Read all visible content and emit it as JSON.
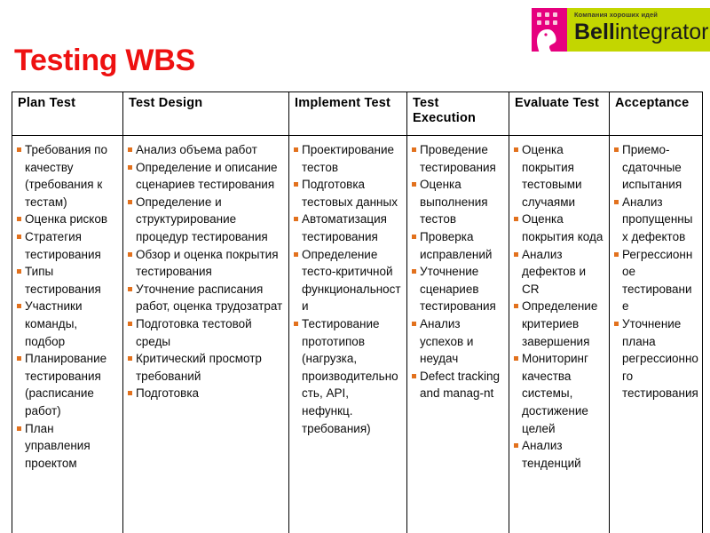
{
  "slide": {
    "title": "Testing WBS",
    "title_color": "#ee1111",
    "background_color": "#ffffff"
  },
  "logo": {
    "tagline": "Компания хороших идей",
    "wordmark_bold": "Bell",
    "wordmark_regular": "integrator",
    "mark_color": "#e6007e",
    "panel_color": "#c3d600",
    "dot_color": "#f9c8dd"
  },
  "table": {
    "bullet_color": "#e2711d",
    "border_color": "#000000",
    "columns": [
      {
        "header": "Plan Test",
        "items": [
          "Требования по качеству (требования к тестам)",
          "Оценка рисков",
          "Стратегия тестирования",
          "Типы тестирования",
          "Участники команды, подбор",
          "Планирование тестирования (расписание работ)",
          "План управления проектом"
        ]
      },
      {
        "header": "Test Design",
        "items": [
          "Анализ объема работ",
          "Определение и описание сценариев тестирования",
          "Определение и структурирование процедур тестирования",
          "Обзор и оценка покрытия тестирования",
          "Уточнение расписания работ, оценка трудозатрат",
          "Подготовка тестовой среды",
          "Критический просмотр требований",
          "Подготовка"
        ]
      },
      {
        "header": "Implement Test",
        "items": [
          "Проектирование тестов",
          "Подготовка тестовых данных",
          "Автоматизация тестирования",
          "Определение тесто-критичной функциональности",
          "Тестирование прототипов (нагрузка, производительность, API, нефункц. требования)"
        ]
      },
      {
        "header": "Test Execution",
        "items": [
          "Проведение тестирования",
          "Оценка выполнения тестов",
          "Проверка исправлений",
          "Уточнение сценариев тестирования",
          "Анализ успехов и неудач",
          "Defect tracking and manag-nt"
        ]
      },
      {
        "header": "Evaluate Test",
        "items": [
          "Оценка покрытия тестовыми случаями",
          "Оценка покрытия кода",
          "Анализ дефектов и CR",
          "Определение критериев завершения",
          "Мониторинг качества системы, достижение целей",
          "Анализ тенденций"
        ]
      },
      {
        "header": "Acceptance",
        "items": [
          "Приемо-сдаточные испытания",
          "Анализ пропущенных дефектов",
          "Регрессионное тестирование",
          "Уточнение плана регрессионного тестирования"
        ]
      }
    ]
  }
}
